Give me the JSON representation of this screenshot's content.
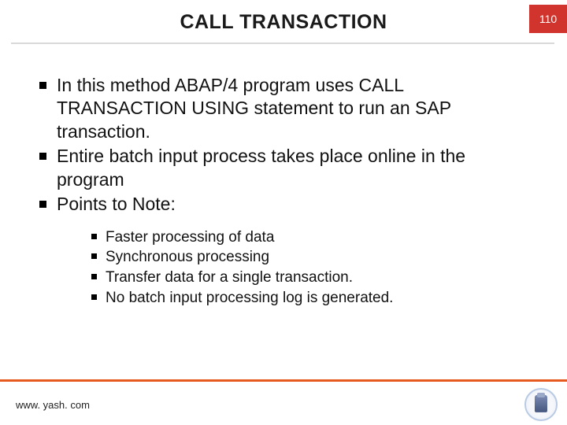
{
  "header": {
    "title": "CALL TRANSACTION",
    "page_number": "110"
  },
  "bullets": [
    "In this method ABAP/4 program uses CALL TRANSACTION USING statement to run an SAP transaction.",
    "Entire batch input process takes place online in the program",
    "Points to Note:"
  ],
  "sub_bullets": [
    "Faster processing of data",
    "Synchronous processing",
    "Transfer data for a single transaction.",
    "No batch input processing log is generated."
  ],
  "footer": {
    "url": "www. yash. com"
  }
}
